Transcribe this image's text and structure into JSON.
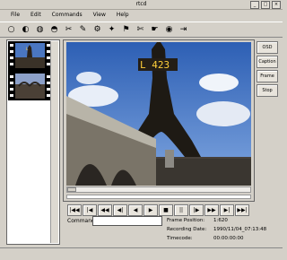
{
  "window": {
    "title": "rtcd"
  },
  "menu": [
    "File",
    "Edit",
    "Commands",
    "View",
    "Help"
  ],
  "toolbar_icons": [
    "new-icon",
    "open-icon",
    "save-icon",
    "cut-icon",
    "copy-icon",
    "paste-icon",
    "settings-icon",
    "tool-icon",
    "camera-icon",
    "scissors-icon",
    "hand-icon",
    "burn-icon",
    "exit-icon"
  ],
  "side_buttons": [
    "OSD",
    "Caption",
    "Frame",
    "Stop"
  ],
  "controls": [
    "|◀◀",
    "|◀",
    "◀◀",
    "◀|",
    "◀",
    "▶",
    "■",
    "||",
    "|▶",
    "▶▶",
    "▶|",
    "▶▶|"
  ],
  "command": {
    "label": "Command",
    "value": ""
  },
  "info": {
    "frame_position_label": "Frame Position:",
    "frame_position": "1:620",
    "recording_date_label": "Recording Date:",
    "recording_date": "1990/11/04_07:13:48",
    "timecode_label": "Timecode:",
    "timecode": "00:00:00:00"
  },
  "overlay_text": "L 423",
  "colors": {
    "sky": "#3f6fb8",
    "accent": "#203a80"
  }
}
